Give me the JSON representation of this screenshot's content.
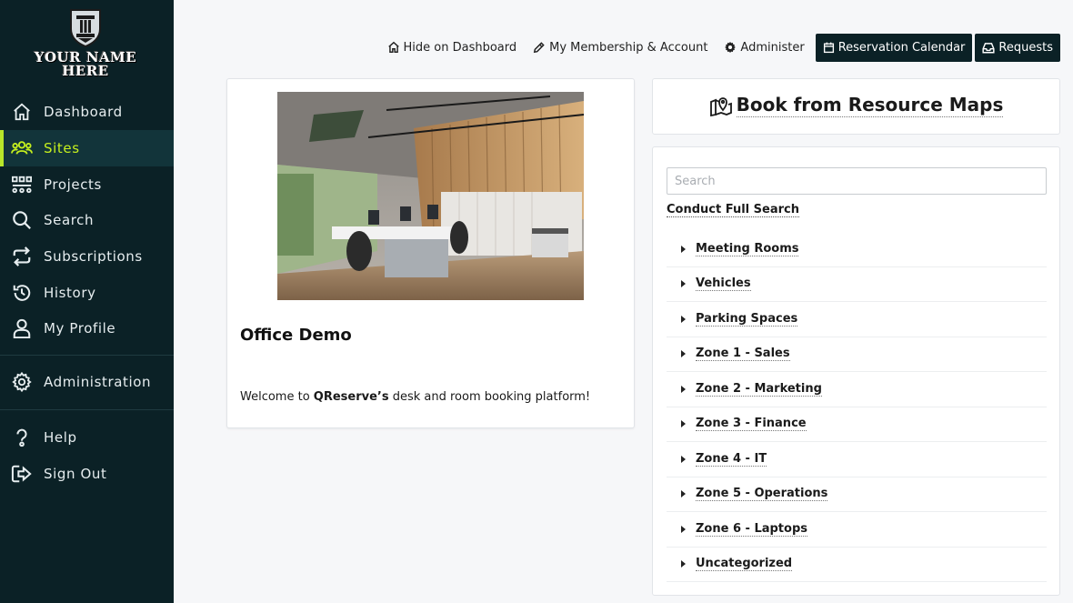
{
  "brand": {
    "logo_line1": "YOUR NAME",
    "logo_line2": "HERE"
  },
  "sidebar": {
    "active_color": "#c6f01e",
    "bg_color": "#0b2126",
    "items": [
      {
        "label": "Dashboard",
        "icon": "home-icon"
      },
      {
        "label": "Sites",
        "icon": "users-icon"
      },
      {
        "label": "Projects",
        "icon": "project-grid-icon"
      },
      {
        "label": "Search",
        "icon": "search-icon"
      },
      {
        "label": "Subscriptions",
        "icon": "repeat-icon"
      },
      {
        "label": "History",
        "icon": "history-icon"
      },
      {
        "label": "My Profile",
        "icon": "user-icon"
      },
      {
        "label": "Administration",
        "icon": "gear-icon"
      },
      {
        "label": "Help",
        "icon": "help-icon"
      },
      {
        "label": "Sign Out",
        "icon": "sign-out-icon"
      }
    ]
  },
  "toolbar": {
    "hide_label": "Hide on Dashboard",
    "membership_label": "My Membership & Account",
    "administer_label": "Administer",
    "calendar_label": "Reservation Calendar",
    "requests_label": "Requests"
  },
  "site": {
    "title": "Office Demo",
    "desc_prefix": "Welcome to ",
    "desc_brand": "QReserve’s",
    "desc_suffix": " desk and room booking platform!"
  },
  "maps": {
    "label": "Book from Resource Maps"
  },
  "resources": {
    "search_placeholder": "Search",
    "full_search_label": "Conduct Full Search",
    "items": [
      "Meeting Rooms",
      "Vehicles",
      "Parking Spaces",
      "Zone 1 - Sales",
      "Zone 2 - Marketing",
      "Zone 3 - Finance",
      "Zone 4 - IT",
      "Zone 5 - Operations",
      "Zone 6 - Laptops",
      "Uncategorized"
    ]
  }
}
